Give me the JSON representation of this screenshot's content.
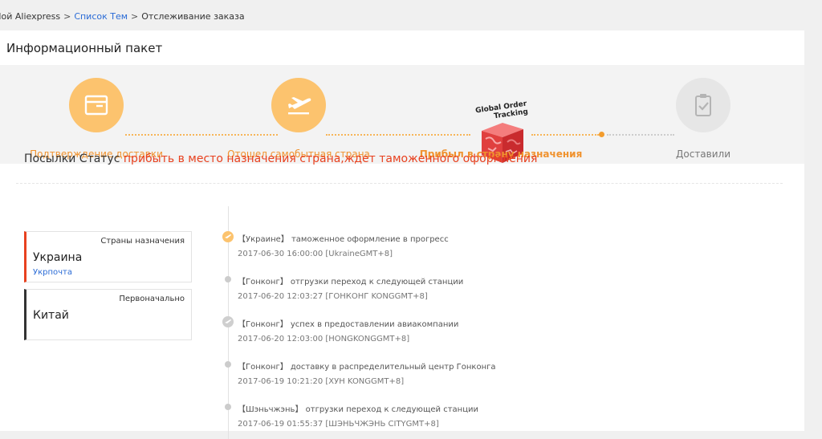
{
  "breadcrumb": {
    "home": "Мой Aliexpress",
    "sep": ">",
    "list": "Список Тем",
    "current": "Отслеживание заказа"
  },
  "panel": {
    "title": "Информационный пакет"
  },
  "tracker": {
    "badge": {
      "line1": "Global Order",
      "line2": "Tracking"
    },
    "steps": [
      {
        "label": "Подтверждение доставки",
        "icon": "package-icon"
      },
      {
        "label": "Отошел самобытная страна",
        "icon": "airplane-takeoff-icon"
      },
      {
        "label": "Прибыл в страну назначения",
        "icon": "global-tracking-box-icon"
      },
      {
        "label": "Доставили",
        "icon": "clipboard-check-icon"
      }
    ]
  },
  "status": {
    "prefix": "Посылки Статус",
    "value": "прибыть в место назначения страна,ждет таможенного оформления"
  },
  "destination": {
    "label": "Страны назначения",
    "country": "Украина",
    "carrier": "Укрпочта"
  },
  "origin": {
    "label": "Первоначально",
    "country": "Китай"
  },
  "events": [
    {
      "desc": "【Украине】 таможенное оформление в прогресс",
      "time": "2017-06-30 16:00:00 [UkraineGMT+8]"
    },
    {
      "desc": "【Гонконг】 отгрузки переход к следующей станции",
      "time": "2017-06-20 12:03:27 [ГОНКОНГ KONGGMT+8]"
    },
    {
      "desc": "【Гонконг】 успех в предоставлении авиакомпании",
      "time": "2017-06-20 12:03:00 [HONGKONGGMT+8]"
    },
    {
      "desc": "【Гонконг】 доставку в распределительный центр Гонконга",
      "time": "2017-06-19 10:21:20 [ХУН KONGGMT+8]"
    },
    {
      "desc": "【Шэньчжэнь】 отгрузки переход к следующей станции",
      "time": "2017-06-19 01:55:37 [ШЭНЬЧЖЭНЬ CITYGMT+8]"
    }
  ],
  "colors": {
    "accent": "#f0922e",
    "status": "#e8411f",
    "link": "#2a6bd6",
    "stepFill": "#fcc36e"
  }
}
